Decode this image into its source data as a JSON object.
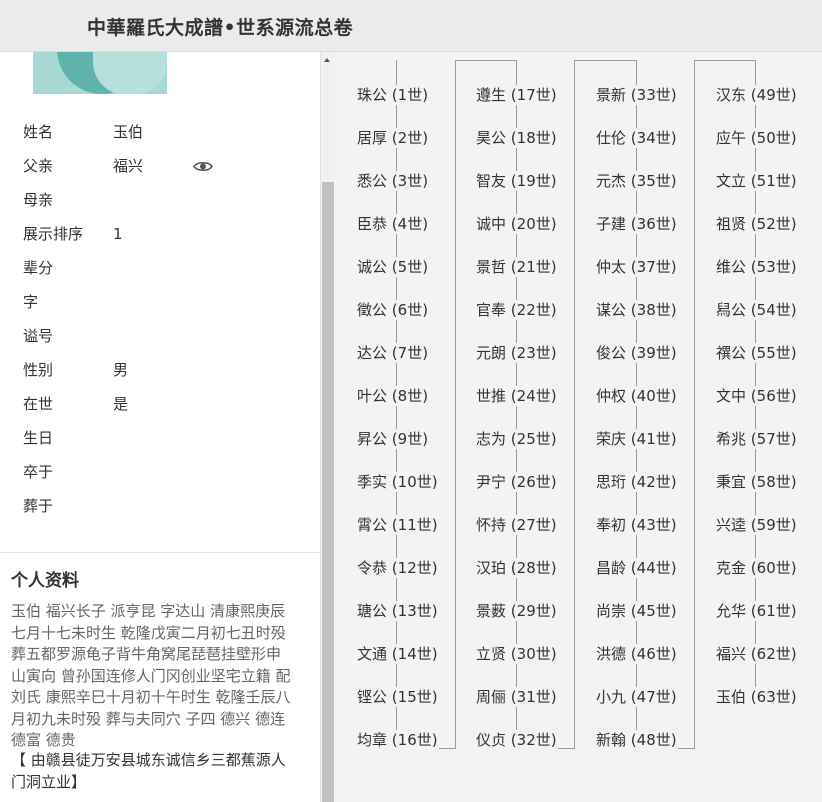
{
  "header": {
    "title": "中華羅氏大成譜•世系源流总卷"
  },
  "person": {
    "fields": [
      {
        "label": "姓名",
        "value": "玉伯"
      },
      {
        "label": "父亲",
        "value": "福兴",
        "icon": "eye-icon"
      },
      {
        "label": "母亲",
        "value": ""
      },
      {
        "label": "展示排序",
        "value": "1"
      },
      {
        "label": "辈分",
        "value": ""
      },
      {
        "label": "字",
        "value": ""
      },
      {
        "label": "谥号",
        "value": ""
      },
      {
        "label": "性别",
        "value": "男"
      },
      {
        "label": "在世",
        "value": "是"
      },
      {
        "label": "生日",
        "value": ""
      },
      {
        "label": "卒于",
        "value": ""
      },
      {
        "label": "葬于",
        "value": ""
      }
    ]
  },
  "profile": {
    "title": "个人资料",
    "lines": [
      "玉伯 福兴长子 派亨昆 字达山 清康熙庚辰",
      "七月十七未时生 乾隆戊寅二月初七丑时殁",
      "葬五都罗源龟子背牛角窝尾琵琶挂壁形申",
      "山寅向 曾孙国连修人门冈创业坚宅立籍 配",
      "刘氏 康熙辛巳十月初十午时生 乾隆壬辰八",
      "月初九未时殁 葬与夫同穴 子四 德兴 德连",
      "德富 德贵"
    ],
    "origin_lines": [
      "【 由赣县徒万安县城东诚信乡三都蕉源人",
      "门洞立业】"
    ]
  },
  "generations": {
    "columns": [
      [
        {
          "name": "珠公",
          "gen": "(1世)"
        },
        {
          "name": "居厚",
          "gen": "(2世)"
        },
        {
          "name": "悉公",
          "gen": "(3世)"
        },
        {
          "name": "臣恭",
          "gen": "(4世)"
        },
        {
          "name": "诚公",
          "gen": "(5世)"
        },
        {
          "name": "徵公",
          "gen": "(6世)"
        },
        {
          "name": "达公",
          "gen": "(7世)"
        },
        {
          "name": "叶公",
          "gen": "(8世)"
        },
        {
          "name": "昇公",
          "gen": "(9世)"
        },
        {
          "name": "季实",
          "gen": "(10世)"
        },
        {
          "name": "霄公",
          "gen": "(11世)"
        },
        {
          "name": "令恭",
          "gen": "(12世)"
        },
        {
          "name": "瑭公",
          "gen": "(13世)"
        },
        {
          "name": "文通",
          "gen": "(14世)"
        },
        {
          "name": "铿公",
          "gen": "(15世)"
        },
        {
          "name": "均章",
          "gen": "(16世)"
        }
      ],
      [
        {
          "name": "遵生",
          "gen": "(17世)"
        },
        {
          "name": "昊公",
          "gen": "(18世)"
        },
        {
          "name": "智友",
          "gen": "(19世)"
        },
        {
          "name": "诚中",
          "gen": "(20世)"
        },
        {
          "name": "景哲",
          "gen": "(21世)"
        },
        {
          "name": "官奉",
          "gen": "(22世)"
        },
        {
          "name": "元朗",
          "gen": "(23世)"
        },
        {
          "name": "世推",
          "gen": "(24世)"
        },
        {
          "name": "志为",
          "gen": "(25世)"
        },
        {
          "name": "尹宁",
          "gen": "(26世)"
        },
        {
          "name": "怀持",
          "gen": "(27世)"
        },
        {
          "name": "汉珀",
          "gen": "(28世)"
        },
        {
          "name": "景薮",
          "gen": "(29世)"
        },
        {
          "name": "立贤",
          "gen": "(30世)"
        },
        {
          "name": "周俪",
          "gen": "(31世)"
        },
        {
          "name": "仪贞",
          "gen": "(32世)"
        }
      ],
      [
        {
          "name": "景新",
          "gen": "(33世)"
        },
        {
          "name": "仕伦",
          "gen": "(34世)"
        },
        {
          "name": "元杰",
          "gen": "(35世)"
        },
        {
          "name": "子建",
          "gen": "(36世)"
        },
        {
          "name": "仲太",
          "gen": "(37世)"
        },
        {
          "name": "谋公",
          "gen": "(38世)"
        },
        {
          "name": "俊公",
          "gen": "(39世)"
        },
        {
          "name": "仲权",
          "gen": "(40世)"
        },
        {
          "name": "荣庆",
          "gen": "(41世)"
        },
        {
          "name": "思珩",
          "gen": "(42世)"
        },
        {
          "name": "奉初",
          "gen": "(43世)"
        },
        {
          "name": "昌龄",
          "gen": "(44世)"
        },
        {
          "name": "尚崇",
          "gen": "(45世)"
        },
        {
          "name": "洪德",
          "gen": "(46世)"
        },
        {
          "name": "小九",
          "gen": "(47世)"
        },
        {
          "name": "新翰",
          "gen": "(48世)"
        }
      ],
      [
        {
          "name": "汉东",
          "gen": "(49世)"
        },
        {
          "name": "应午",
          "gen": "(50世)"
        },
        {
          "name": "文立",
          "gen": "(51世)"
        },
        {
          "name": "祖贤",
          "gen": "(52世)"
        },
        {
          "name": "维公",
          "gen": "(53世)"
        },
        {
          "name": "舄公",
          "gen": "(54世)"
        },
        {
          "name": "禩公",
          "gen": "(55世)"
        },
        {
          "name": "文中",
          "gen": "(56世)"
        },
        {
          "name": "希兆",
          "gen": "(57世)"
        },
        {
          "name": "秉宜",
          "gen": "(58世)"
        },
        {
          "name": "兴逵",
          "gen": "(59世)"
        },
        {
          "name": "克金",
          "gen": "(60世)"
        },
        {
          "name": "允华",
          "gen": "(61世)"
        },
        {
          "name": "福兴",
          "gen": "(62世)"
        },
        {
          "name": "玉伯",
          "gen": "(63世)"
        }
      ]
    ]
  }
}
